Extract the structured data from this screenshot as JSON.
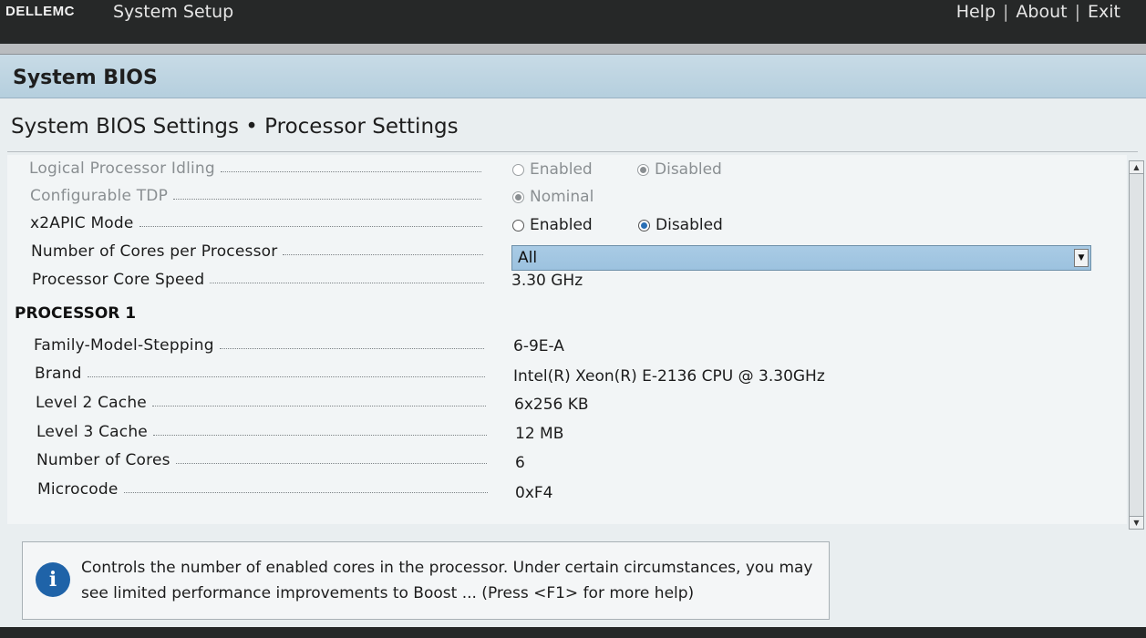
{
  "header": {
    "brand": "DELLEMC",
    "title": "System Setup",
    "links": [
      "Help",
      "About",
      "Exit"
    ],
    "separator": "|"
  },
  "banner": {
    "title": "System BIOS"
  },
  "page": {
    "heading": "System BIOS Settings • Processor Settings"
  },
  "settings": [
    {
      "label": "Logical Processor Idling",
      "type": "radio",
      "disabled": true,
      "options": [
        "Enabled",
        "Disabled"
      ],
      "selected": "Disabled"
    },
    {
      "label": "Configurable TDP",
      "type": "radio",
      "disabled": true,
      "options": [
        "Nominal"
      ],
      "selected": "Nominal"
    },
    {
      "label": "x2APIC Mode",
      "type": "radio",
      "disabled": false,
      "options": [
        "Enabled",
        "Disabled"
      ],
      "selected": "Disabled"
    },
    {
      "label": "Number of Cores per Processor",
      "type": "select",
      "value": "All"
    },
    {
      "label": "Processor Core Speed",
      "type": "text",
      "value": "3.30 GHz"
    }
  ],
  "processor": {
    "heading": "PROCESSOR 1",
    "rows": [
      {
        "label": "Family-Model-Stepping",
        "value": "6-9E-A"
      },
      {
        "label": "Brand",
        "value": "Intel(R) Xeon(R) E-2136 CPU @ 3.30GHz"
      },
      {
        "label": "Level 2 Cache",
        "value": "6x256 KB"
      },
      {
        "label": "Level 3 Cache",
        "value": "12 MB"
      },
      {
        "label": "Number of Cores",
        "value": "6"
      },
      {
        "label": "Microcode",
        "value": "0xF4"
      }
    ]
  },
  "help": {
    "icon": "info-icon",
    "text": "Controls the number of enabled cores in the processor. Under certain circumstances, you may see limited performance improvements to Boost ... (Press <F1> for more help)"
  },
  "colors": {
    "header_bg": "#262828",
    "banner_bg": "#b5cfde",
    "select_bg": "#9cc2df",
    "radio_on": "#2a6fb5",
    "info_icon": "#1f63a8"
  }
}
